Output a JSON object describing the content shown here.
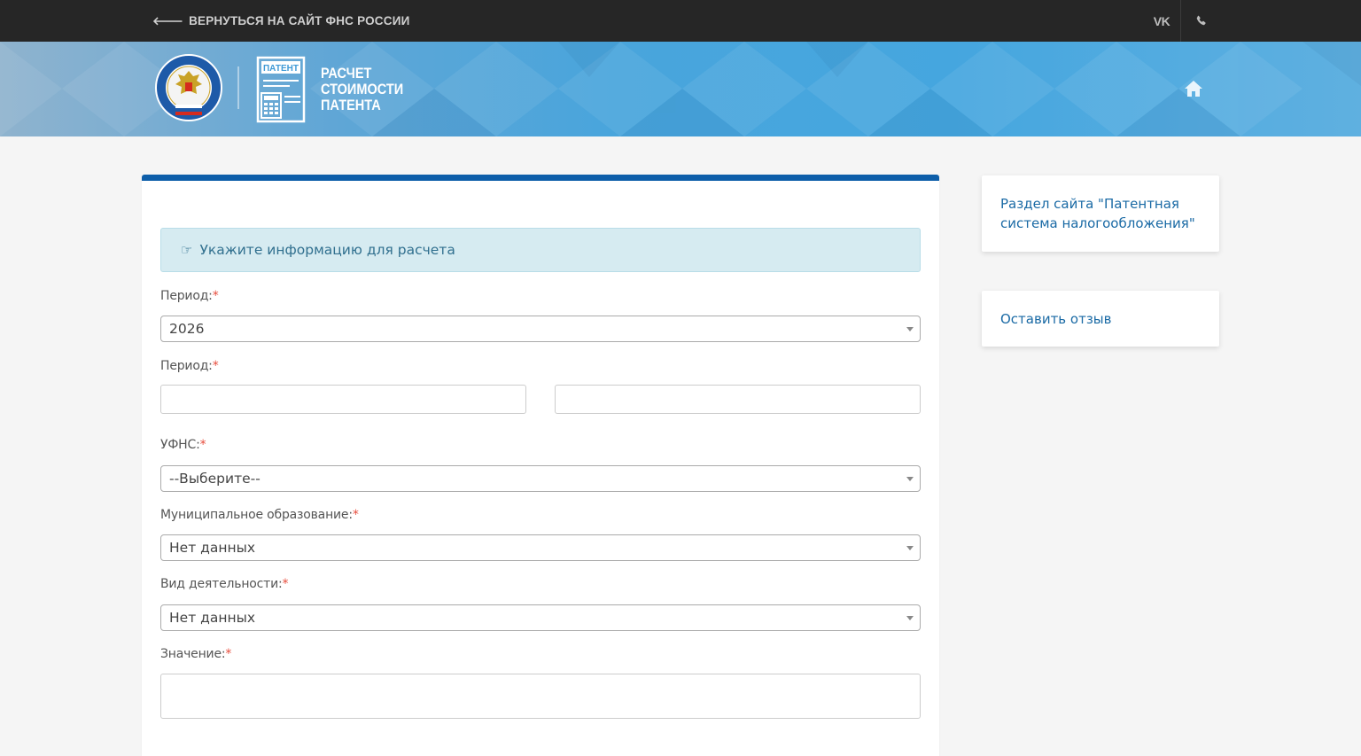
{
  "topbar": {
    "back_link": "ВЕРНУТЬСЯ НА САЙТ ФНС РОССИИ",
    "vk_label": "VK"
  },
  "header": {
    "app_title_lines": [
      "РАСЧЕТ",
      "СТОИМОСТИ",
      "ПАТЕНТА"
    ],
    "doc_badge": "ПАТЕНТ"
  },
  "form": {
    "info_message": "Укажите информацию для расчета",
    "required_mark": "*",
    "period_year": {
      "label": "Период:",
      "value": "2026"
    },
    "period_range": {
      "label": "Период:",
      "from_value": "",
      "to_value": ""
    },
    "ufns": {
      "label": "УФНС:",
      "value": "--Выберите--"
    },
    "municipality": {
      "label": "Муниципальное образование:",
      "value": "Нет данных"
    },
    "activity": {
      "label": "Вид деятельности:",
      "value": "Нет данных"
    },
    "value_field": {
      "label": "Значение:",
      "value": ""
    }
  },
  "sidebar": {
    "patent_section_link": "Раздел сайта \"Патентная система налогообложения\"",
    "feedback_link": "Оставить отзыв"
  },
  "colors": {
    "topbar_bg": "#262626",
    "accent_blue": "#0d5ea9",
    "info_bg": "#d6ebf1",
    "link": "#1a6aa5",
    "required": "#e74c3c"
  },
  "icons": [
    "arrow-left-icon",
    "vk-icon",
    "phone-icon",
    "home-icon",
    "hand-point-icon",
    "dropdown-caret-icon"
  ]
}
